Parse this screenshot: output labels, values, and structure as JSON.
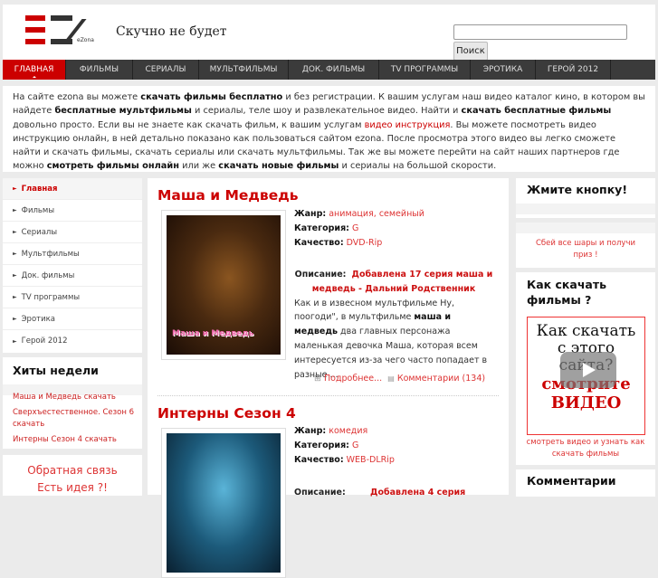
{
  "header": {
    "logo_text": "eZona",
    "slogan": "Скучно не будет",
    "search_placeholder": "",
    "search_button": "Поиск"
  },
  "nav": [
    {
      "label": "ГЛАВНАЯ",
      "active": true
    },
    {
      "label": "ФИЛЬМЫ"
    },
    {
      "label": "СЕРИАЛЫ"
    },
    {
      "label": "МУЛЬТФИЛЬМЫ"
    },
    {
      "label": "ДОК. ФИЛЬМЫ"
    },
    {
      "label": "TV ПРОГРАММЫ"
    },
    {
      "label": "ЭРОТИКА"
    },
    {
      "label": "ГЕРОЙ 2012"
    }
  ],
  "intro": {
    "p1": "На сайте ezona вы можете ",
    "b1": "скачать фильмы бесплатно",
    "p2": " и без регистрации. К вашим услугам наш видео каталог кино, в котором вы найдете ",
    "b2": "бесплатные мультфильмы",
    "p3": " и сериалы, теле шоу и развлекательное видео. Найти и ",
    "b3": "скачать бесплатные фильмы",
    "p4": " довольно просто. Если вы не знаете как скачать фильм, к вашим услугам ",
    "link": "видео инструкция",
    "p5": ". Вы можете посмотреть видео инструкцию онлайн, в ней детально показано как пользоваться сайтом ezona. После просмотра этого видео вы легко сможете найти и скачать фильмы, скачать сериалы или скачать мультфильмы. Так же вы можете перейти на сайт наших партнеров где можно ",
    "b4": "смотреть фильмы онлайн",
    "p6": " или же ",
    "b5": "скачать новые фильмы",
    "p7": " и сериалы на большой скорости."
  },
  "left_menu": [
    "Главная",
    "Фильмы",
    "Сериалы",
    "Мультфильмы",
    "Док. фильмы",
    "TV программы",
    "Эротика",
    "Герой 2012"
  ],
  "hits": {
    "title": "Хиты недели",
    "items": [
      "Маша и Медведь скачать",
      "Сверхъестественное. Сезон 6 скачать",
      "Интерны Сезон 4 скачать"
    ]
  },
  "feedback": {
    "line1": "Обратная связь",
    "line2": "Есть идея ?!"
  },
  "labels": {
    "genre": "Жанр:",
    "category": "Категория:",
    "quality": "Качество:",
    "description": "Описание:"
  },
  "articles": [
    {
      "title": "Маша и Медведь",
      "poster_text": "Маша и Медведь",
      "genre": "анимация, семейный",
      "category": "G",
      "quality": "DVD-Rip",
      "desc_title": "Добавлена 17 серия маша и медведь - Дальний Родственник",
      "desc_1": "Как и в извесном мультфильме  Ну, поогоди\", в мультфильме ",
      "desc_bold": "маша и медведь",
      "desc_2": " два главных персонажа   маленькая девочка Маша, которая всем интересуется из-за чего часто попадает в разные ...",
      "more": "Подробнее...",
      "comments": "Комментарии (134)"
    },
    {
      "title": "Интерны Сезон 4",
      "genre": "комедия",
      "category": "G",
      "quality": "WEB-DLRip",
      "desc_title": "Добавлена 4 серия"
    }
  ],
  "right": {
    "press_title": "Жмите кнопку!",
    "game_text": "Сбей все шары и получи приз !",
    "howto_title": "Как скачать фильмы ?",
    "video_line1": "Как скачать",
    "video_line2": "с этого",
    "video_line3": "сайта?",
    "video_line4": "смотрите",
    "video_line5": "ВИДЕО",
    "video_caption": "смотреть видео и узнать как скачать фильмы",
    "comments_title": "Комментарии"
  }
}
